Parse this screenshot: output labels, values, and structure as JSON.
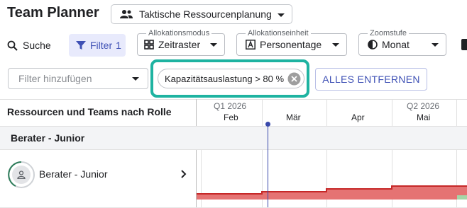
{
  "app": {
    "title": "Team Planner",
    "view_select": {
      "icon": "people-icon",
      "label": "Taktische Ressourcenplanung"
    }
  },
  "toolbar": {
    "search_label": "Suche",
    "filter_label": "Filter",
    "filter_count": "1",
    "allocation_mode": {
      "legend": "Allokationsmodus",
      "value": "Zeitraster",
      "icon": "grid-icon"
    },
    "allocation_unit": {
      "legend": "Allokationseinheit",
      "value": "Personentage",
      "icon": "letter-a-box-icon"
    },
    "zoom": {
      "legend": "Zoomstufe",
      "value": "Monat",
      "icon": "half-circle-icon"
    }
  },
  "filters": {
    "input_placeholder": "Filter hinzufügen",
    "active_chip": "Kapazitätsauslastung > 80 %",
    "clear_all_label": "ALLES ENTFERNEN"
  },
  "grid": {
    "title": "Ressourcen und Teams nach Rolle",
    "quarters": [
      "Q1 2026",
      "Q2 2026"
    ],
    "months": [
      "Feb",
      "Mär",
      "Apr",
      "Mai"
    ],
    "group_label": "Berater - Junior",
    "resource_label": "Berater - Junior",
    "utilization_segments": [
      {
        "month": "Feb",
        "level": "over-capacity"
      },
      {
        "month": "Mär",
        "level": "over-capacity"
      },
      {
        "month": "Apr",
        "level": "over-capacity"
      },
      {
        "month": "Mai",
        "level": "over-capacity"
      }
    ]
  },
  "colors": {
    "accent": "#3f51b5",
    "highlight": "#1eb3a1",
    "over_capacity_fill": "#e57373",
    "over_capacity_stroke": "#c62828",
    "under_capacity_fill": "#a5d6a7"
  }
}
